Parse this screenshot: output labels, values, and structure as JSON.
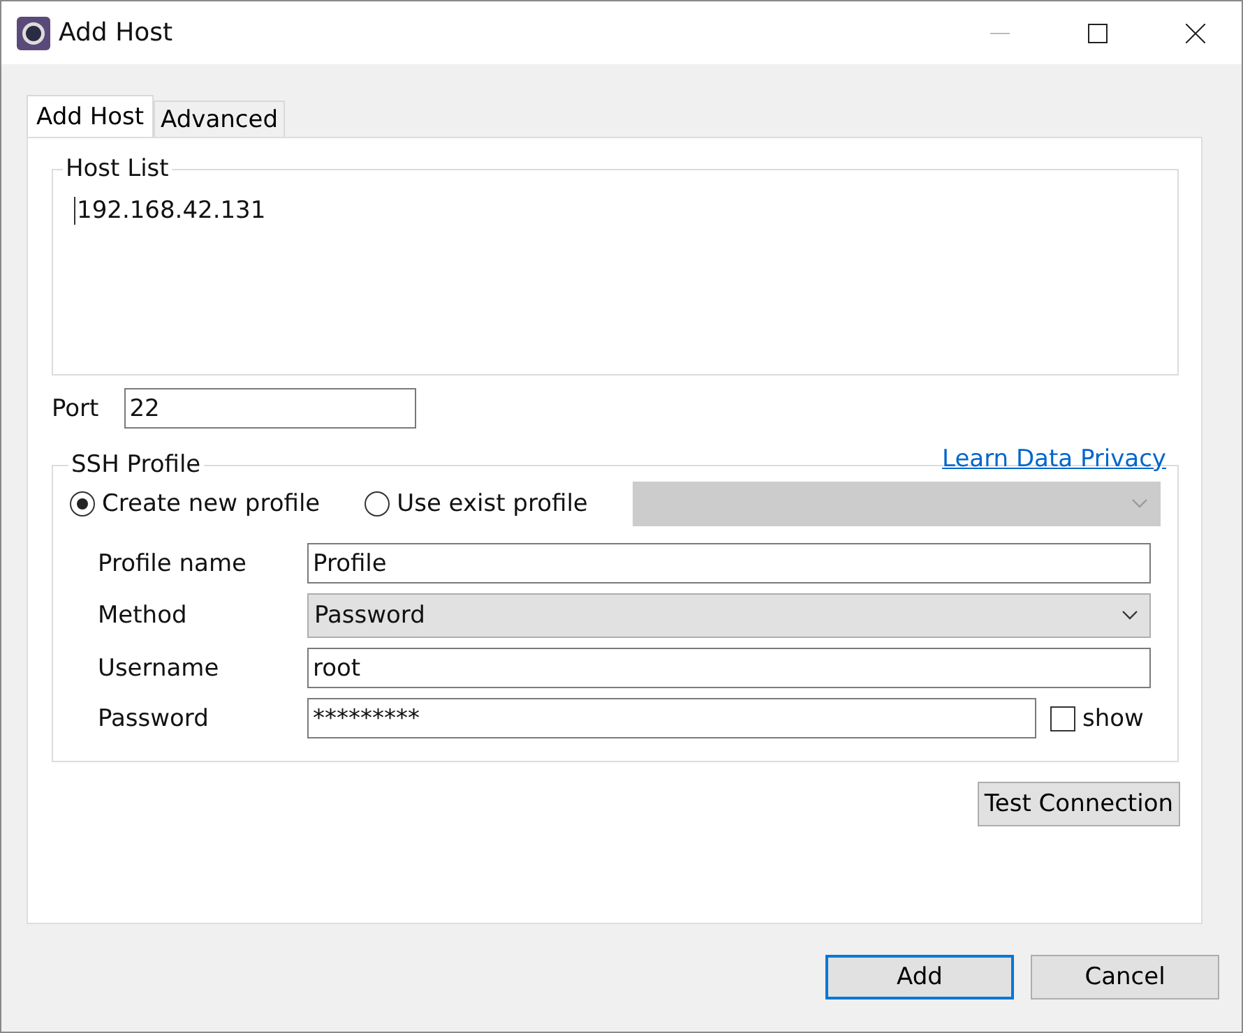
{
  "window": {
    "title": "Add Host"
  },
  "tabs": [
    {
      "label": "Add Host",
      "selected": true
    },
    {
      "label": "Advanced",
      "selected": false
    }
  ],
  "host_list": {
    "legend": "Host List",
    "value": "192.168.42.131"
  },
  "port": {
    "label": "Port",
    "value": "22"
  },
  "ssh_profile": {
    "legend": "SSH Profile",
    "link": "Learn Data Privacy",
    "options": [
      {
        "label": "Create new profile",
        "selected": true
      },
      {
        "label": "Use exist profile",
        "selected": false
      }
    ],
    "existing_profile": {
      "disabled": true
    },
    "fields": [
      {
        "kind": "text",
        "label": "Profile name",
        "value": "Profile"
      },
      {
        "kind": "select",
        "label": "Method",
        "value": "Password"
      },
      {
        "kind": "text",
        "label": "Username",
        "value": "root"
      },
      {
        "kind": "password",
        "label": "Password",
        "value": "*********",
        "show_label": "show",
        "show_checked": false
      }
    ]
  },
  "test_button": "Test Connection",
  "buttons": [
    {
      "label": "Add",
      "default": true
    },
    {
      "label": "Cancel",
      "default": false
    }
  ]
}
